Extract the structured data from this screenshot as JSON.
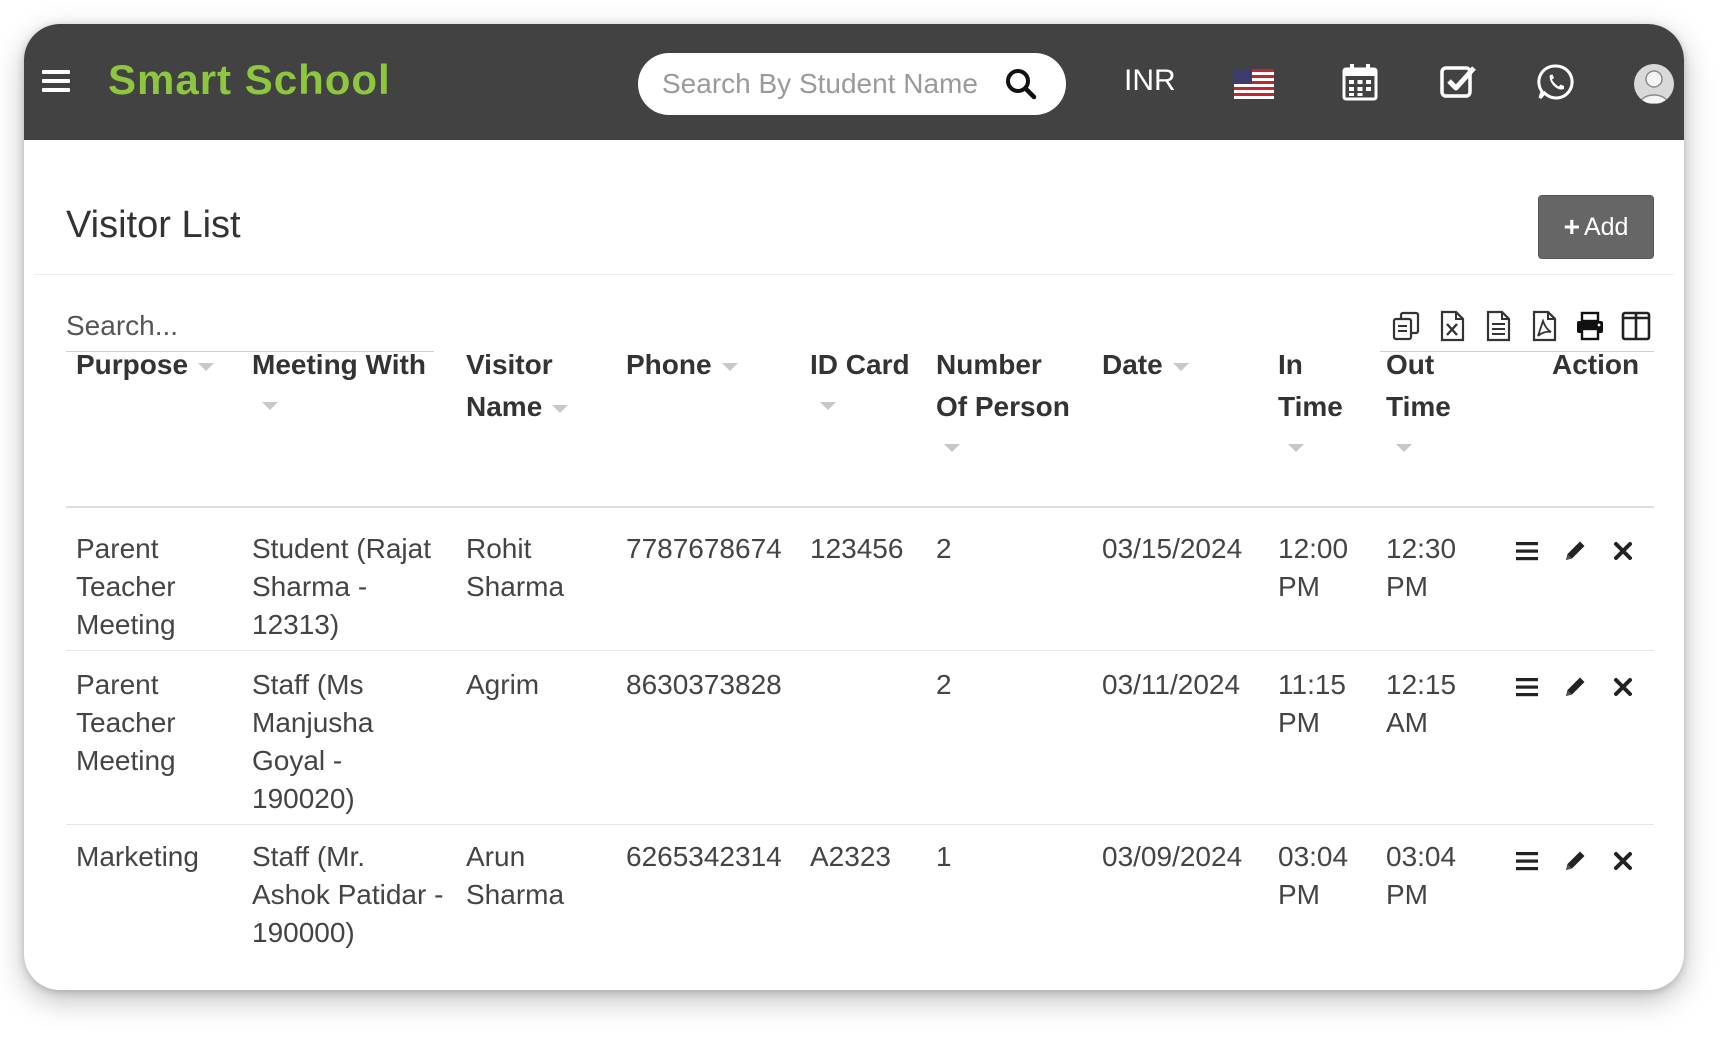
{
  "app": {
    "brand": "Smart School",
    "search_placeholder": "Search By Student Name",
    "currency": "INR",
    "colors": {
      "topbar": "#424242",
      "brand": "#8dc63f",
      "add_button": "#666666"
    }
  },
  "page": {
    "title": "Visitor List",
    "add_button_label": "Add",
    "table_search_placeholder": "Search...",
    "export_tools": [
      "copy-icon",
      "excel-icon",
      "csv-icon",
      "pdf-icon",
      "print-icon",
      "columns-icon"
    ]
  },
  "table": {
    "headers": {
      "purpose": "Purpose",
      "meeting_with": "Meeting With",
      "visitor_name": [
        "Visitor",
        "Name"
      ],
      "phone": "Phone",
      "id_card": "ID Card",
      "number_of_person": [
        "Number",
        "Of Person"
      ],
      "date": "Date",
      "in_time": [
        "In",
        "Time"
      ],
      "out_time": [
        "Out",
        "Time"
      ],
      "action": "Action"
    },
    "rows": [
      {
        "purpose": [
          "Parent",
          "Teacher",
          "Meeting"
        ],
        "meeting_with": [
          "Student (Rajat",
          "Sharma -",
          "12313)"
        ],
        "visitor_name": [
          "Rohit",
          "Sharma"
        ],
        "phone": "7787678674",
        "id_card": "123456",
        "number_of_person": "2",
        "date": "03/15/2024",
        "in_time": [
          "12:00",
          "PM"
        ],
        "out_time": [
          "12:30",
          "PM"
        ]
      },
      {
        "purpose": [
          "Parent",
          "Teacher",
          "Meeting"
        ],
        "meeting_with": [
          "Staff (Ms",
          "Manjusha",
          "Goyal -",
          "190020)"
        ],
        "visitor_name": [
          "Agrim",
          ""
        ],
        "phone": "8630373828",
        "id_card": "",
        "number_of_person": "2",
        "date": "03/11/2024",
        "in_time": [
          "11:15",
          "PM"
        ],
        "out_time": [
          "12:15",
          "AM"
        ]
      },
      {
        "purpose": [
          "Marketing",
          "",
          ""
        ],
        "meeting_with": [
          "Staff (Mr.",
          "Ashok Patidar -",
          "190000)"
        ],
        "visitor_name": [
          "Arun",
          "Sharma"
        ],
        "phone": "6265342314",
        "id_card": "A2323",
        "number_of_person": "1",
        "date": "03/09/2024",
        "in_time": [
          "03:04",
          "PM"
        ],
        "out_time": [
          "03:04",
          "PM"
        ]
      }
    ],
    "row_actions": [
      "view-icon",
      "edit-icon",
      "delete-icon"
    ]
  }
}
